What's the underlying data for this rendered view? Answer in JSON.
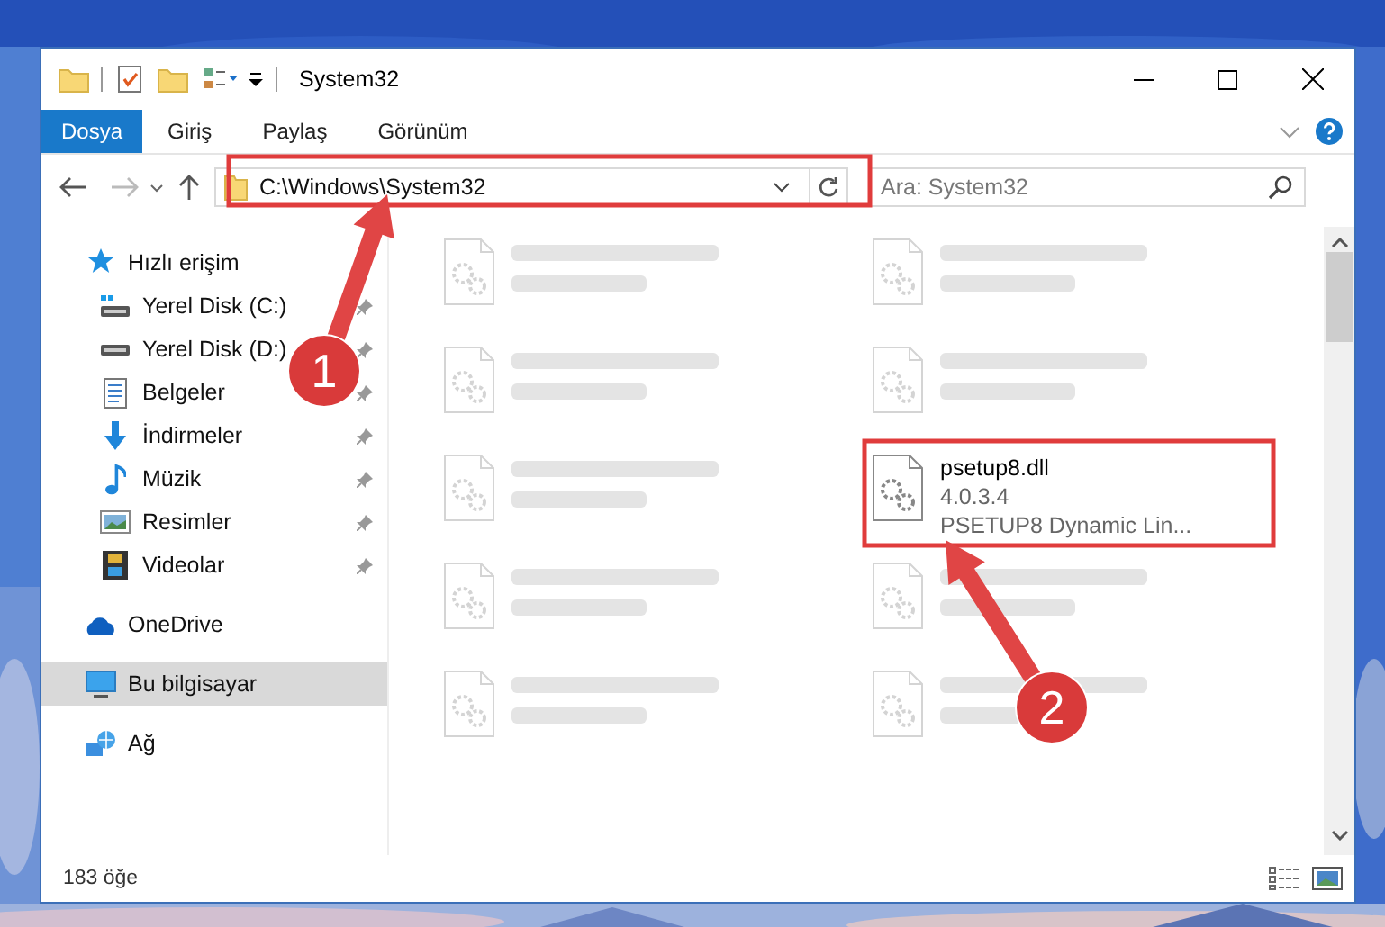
{
  "window": {
    "title": "System32"
  },
  "ribbon": {
    "tabs": [
      {
        "label": "Dosya",
        "kind": "file"
      },
      {
        "label": "Giriş",
        "kind": "tab"
      },
      {
        "label": "Paylaş",
        "kind": "tab"
      },
      {
        "label": "Görünüm",
        "kind": "tab"
      }
    ]
  },
  "navigation": {
    "address": "C:\\Windows\\System32",
    "search": {
      "placeholder": "Ara: System32"
    }
  },
  "sidebar": {
    "items": [
      {
        "label": "Hızlı erişim",
        "selected": false,
        "children": [
          {
            "label": "Yerel Disk (C:)",
            "pinned": true,
            "selected": false
          },
          {
            "label": "Yerel Disk (D:)",
            "pinned": true,
            "selected": false
          },
          {
            "label": "Belgeler",
            "pinned": true,
            "selected": false
          },
          {
            "label": "İndirmeler",
            "pinned": true,
            "selected": false
          },
          {
            "label": "Müzik",
            "pinned": true,
            "selected": false
          },
          {
            "label": "Resimler",
            "pinned": true,
            "selected": false
          },
          {
            "label": "Videolar",
            "pinned": true,
            "selected": false
          }
        ]
      },
      {
        "label": "OneDrive",
        "selected": false
      },
      {
        "label": "Bu bilgisayar",
        "selected": true
      },
      {
        "label": "Ağ",
        "selected": false
      }
    ]
  },
  "files": [
    {
      "kind": "blurred"
    },
    {
      "kind": "blurred"
    },
    {
      "kind": "blurred"
    },
    {
      "kind": "blurred"
    },
    {
      "kind": "blurred"
    },
    {
      "kind": "file",
      "name": "psetup8.dll",
      "lines": [
        "4.0.3.4",
        "PSETUP8 Dynamic Lin..."
      ]
    },
    {
      "kind": "blurred"
    },
    {
      "kind": "blurred"
    },
    {
      "kind": "blurred"
    },
    {
      "kind": "blurred"
    }
  ],
  "status_bar": {
    "count": "183 öğe"
  },
  "annotations": [
    {
      "number": "1"
    },
    {
      "number": "2"
    }
  ]
}
